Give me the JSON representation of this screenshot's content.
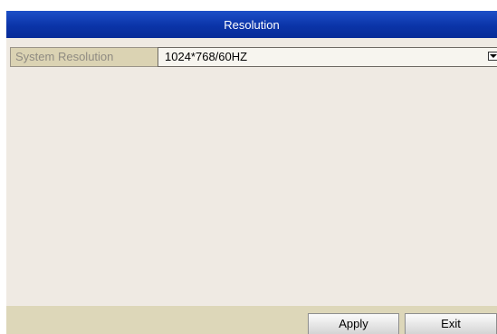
{
  "dialog": {
    "title": "Resolution"
  },
  "fields": {
    "system_resolution": {
      "label": "System Resolution",
      "value": "1024*768/60HZ"
    }
  },
  "footer": {
    "apply_label": "Apply",
    "exit_label": "Exit"
  },
  "icons": {
    "dropdown": "chevron-down-icon"
  }
}
